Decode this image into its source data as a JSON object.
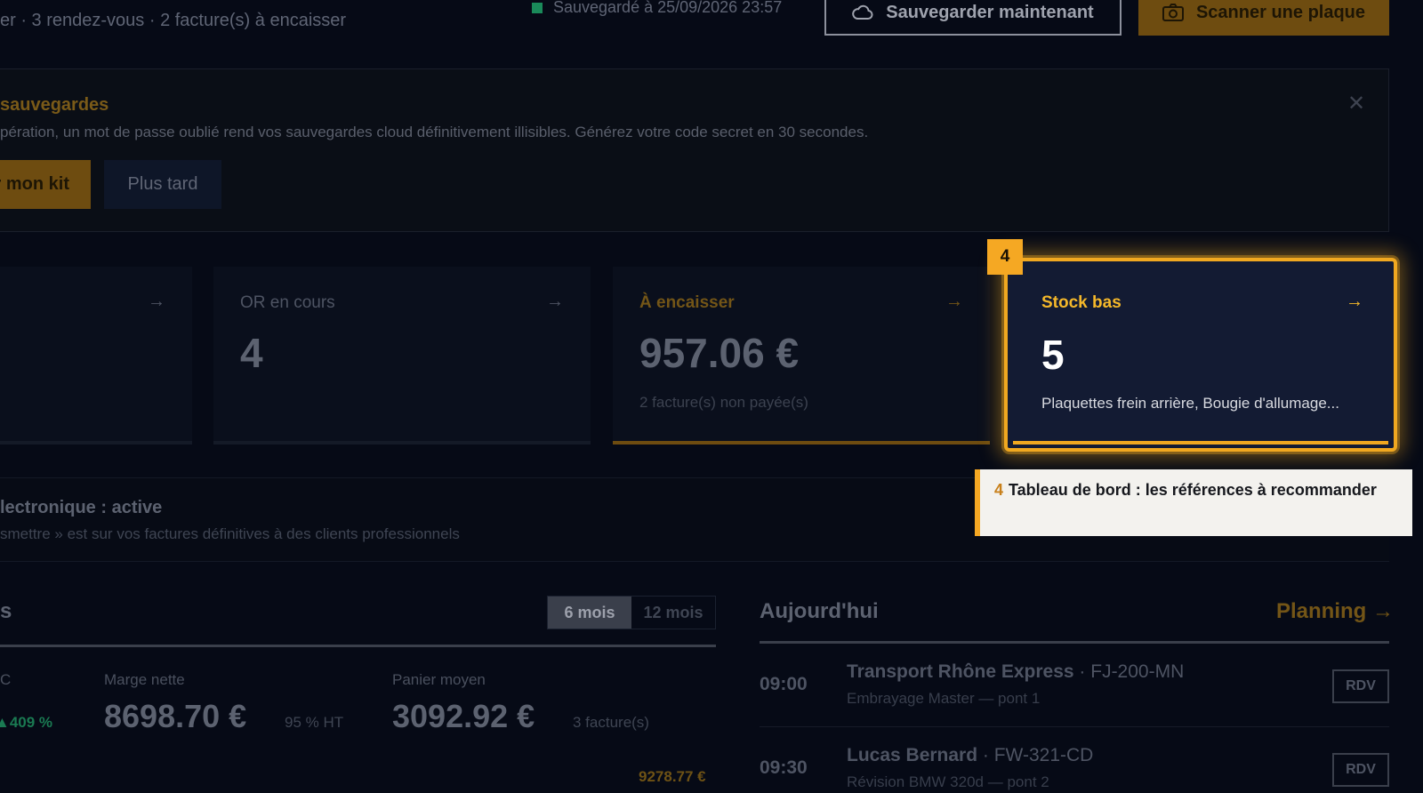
{
  "header": {
    "subtitle": "er · 3 rendez-vous · 2 facture(s) à encaisser",
    "saved_status": "Sauvegardé à 25/09/2026 23:57",
    "save_now_label": "Sauvegarder maintenant",
    "scan_label": "Scanner une plaque"
  },
  "banner": {
    "title": "sauvegardes",
    "text": "pération, un mot de passe oublié rend vos sauvegardes cloud définitivement illisibles. Générez votre code secret en 30 secondes.",
    "primary_label": "r mon kit",
    "later_label": "Plus tard",
    "close_glyph": "✕"
  },
  "cards": [
    {
      "label": "",
      "value": "",
      "sub": ""
    },
    {
      "label": "OR en cours",
      "value": "4",
      "sub": ""
    },
    {
      "label": "À encaisser",
      "value": "957.06 €",
      "sub": "2 facture(s) non payée(s)"
    },
    {
      "label": "Stock bas",
      "value": "5",
      "sub": "Plaquettes frein arrière, Bougie d'allumage..."
    }
  ],
  "arrow_glyph": "→",
  "tour": {
    "step": "4",
    "text": "Tableau de bord : les références à recommander"
  },
  "einvoice": {
    "title": "lectronique : active",
    "text": "smettre » est sur vos factures définitives à des clients professionnels"
  },
  "finance": {
    "title": "s",
    "period_options": [
      "6 mois",
      "12 mois"
    ],
    "period_selected": "6 mois",
    "col0_label": "C",
    "growth": "▲409 %",
    "margin_label": "Marge nette",
    "margin_value": "8698.70 €",
    "margin_note": "95 % HT",
    "basket_label": "Panier moyen",
    "basket_value": "3092.92 €",
    "basket_note": "3 facture(s)",
    "footer_value": "9278.77 €"
  },
  "today": {
    "title": "Aujourd'hui",
    "planning_label": "Planning →",
    "appointments": [
      {
        "time": "09:00",
        "client": "Transport Rhône Express",
        "plate": " · FJ-200-MN",
        "desc": "Embrayage Master — pont 1",
        "tag": "RDV"
      },
      {
        "time": "09:30",
        "client": "Lucas Bernard",
        "plate": " · FW-321-CD",
        "desc": "Révision BMW 320d — pont 2",
        "tag": "RDV"
      }
    ]
  },
  "colors": {
    "accent": "#f5a823",
    "background": "#060a16",
    "card_highlight": "#131b33",
    "success": "#1a7a52"
  }
}
